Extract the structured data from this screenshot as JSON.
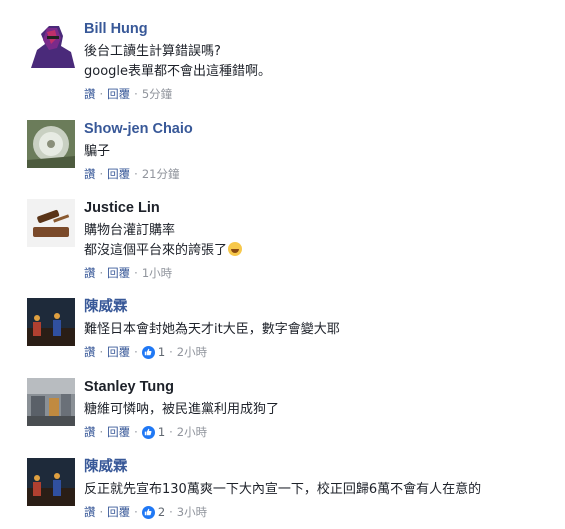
{
  "comments": [
    {
      "name": "Bill Hung",
      "lines": [
        "後台工讀生計算錯誤嗎?",
        "google表單都不會出這種錯啊。"
      ],
      "like_label": "讚",
      "reply_label": "回覆",
      "time": "5分鐘",
      "reactions": ""
    },
    {
      "name": "Show-jen Chaio",
      "lines": [
        "騙子"
      ],
      "like_label": "讚",
      "reply_label": "回覆",
      "time": "21分鐘",
      "reactions": ""
    },
    {
      "name": "Justice Lin",
      "lines": [
        "購物台灌訂購率",
        "都沒這個平台來的誇張了"
      ],
      "emoji": "rolling-on-floor-laughing",
      "like_label": "讚",
      "reply_label": "回覆",
      "time": "1小時",
      "reactions": ""
    },
    {
      "name": "陳威霖",
      "lines": [
        "難怪日本會封她為天才it大臣，數字會變大耶"
      ],
      "like_label": "讚",
      "reply_label": "回覆",
      "time": "2小時",
      "reactions": "1"
    },
    {
      "name": "Stanley Tung",
      "lines": [
        "糖維可憐呐，被民進黨利用成狗了"
      ],
      "like_label": "讚",
      "reply_label": "回覆",
      "time": "2小時",
      "reactions": "1"
    },
    {
      "name": "陳威霖",
      "lines": [
        "反正就先宣布130萬爽一下大內宣一下，校正回歸6萬不會有人在意的"
      ],
      "like_label": "讚",
      "reply_label": "回覆",
      "time": "3小時",
      "reactions": "2"
    }
  ],
  "colors": {
    "name_link": "#385898",
    "meta": "#606770",
    "like_blue": "#2078f4"
  },
  "icons": [
    "avatar-photo",
    "thumbs-up-icon",
    "laughing-emoji-icon"
  ]
}
